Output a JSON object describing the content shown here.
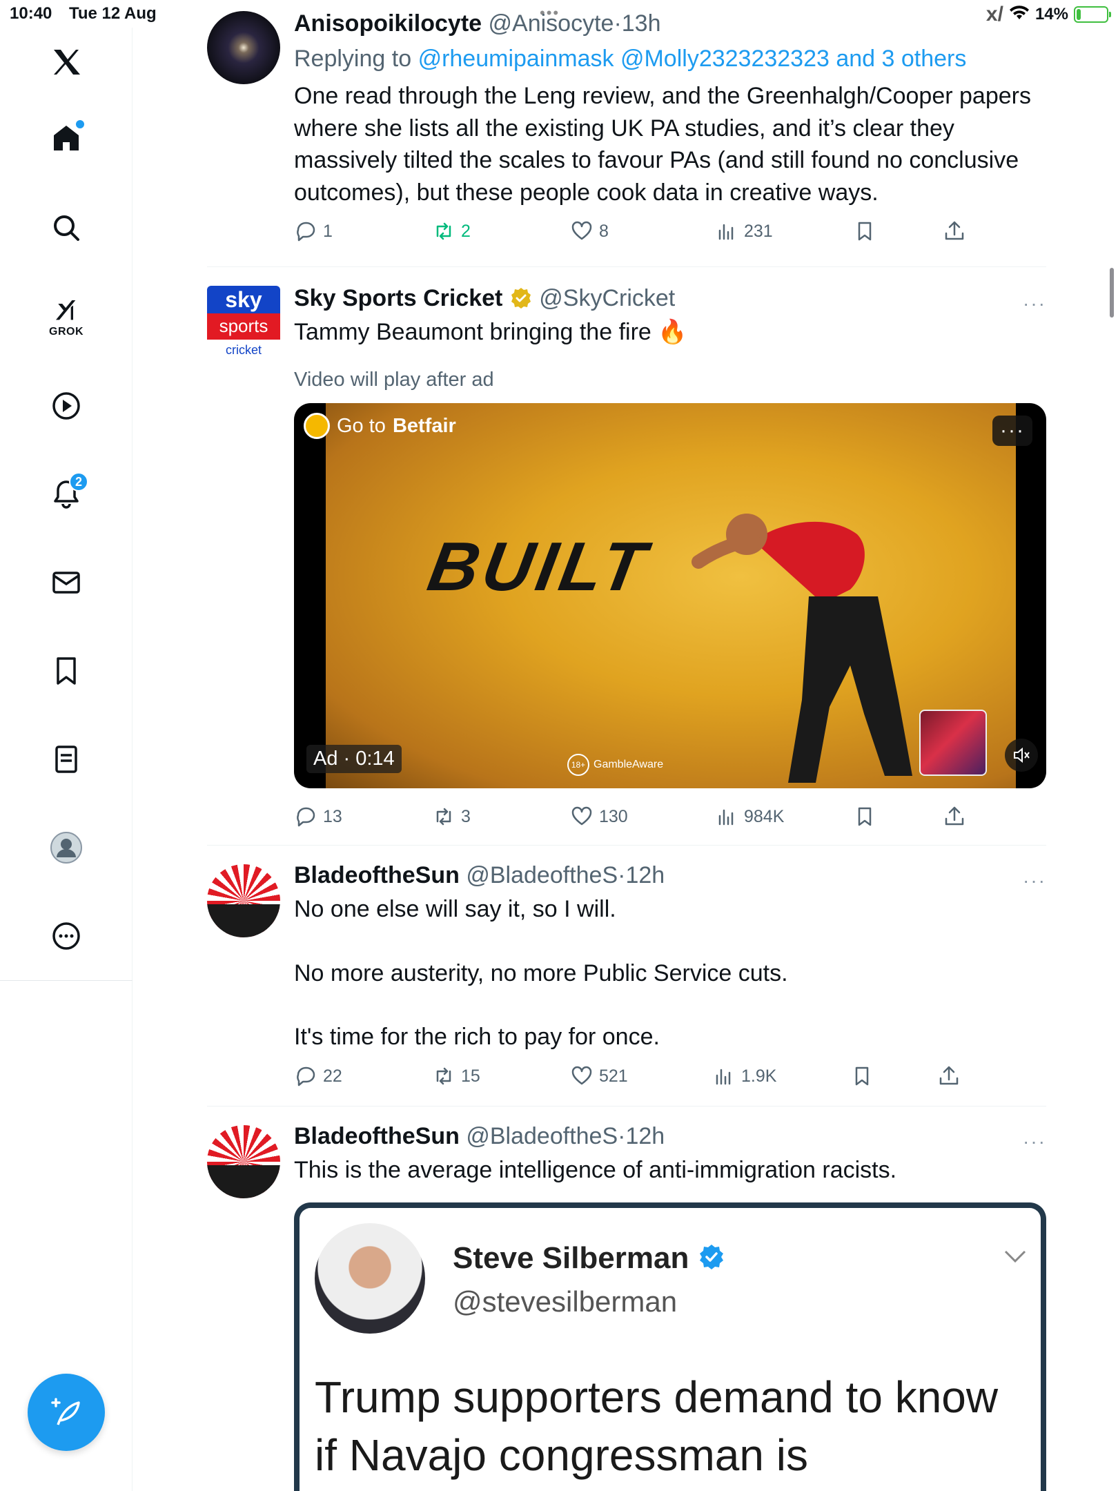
{
  "status_bar": {
    "time": "10:40",
    "date": "Tue 12 Aug",
    "battery": "14%",
    "battery_level": 0.14
  },
  "sidebar": {
    "notifications_badge": "2",
    "grok_label": "GROK",
    "items": [
      "home-icon",
      "search-icon",
      "grok-icon",
      "video-icon",
      "bell-icon",
      "mail-icon",
      "bookmark-icon",
      "lists-icon",
      "profile-icon",
      "more-icon"
    ]
  },
  "tweets": [
    {
      "name": "Anisopoikilocyte",
      "handle": "@Anisocyte",
      "time": "13h",
      "reply_prefix": "Replying to",
      "reply_to": "@rheumipainmask @Molly2323232323 and 3 others",
      "text": "One read through the Leng review, and the Greenhalgh/Cooper papers where she lists all the existing UK PA studies, and it’s clear they massively tilted the scales to favour PAs (and still found no conclusive outcomes), but these people cook data in creative ways.",
      "replies": "1",
      "reposts": "2",
      "likes": "8",
      "views": "231"
    },
    {
      "name": "Sky Sports Cricket",
      "handle": "@SkyCricket",
      "text": "Tammy Beaumont bringing the fire 🔥",
      "video_notice": "Video will play after ad",
      "ad_cta_prefix": "Go to",
      "ad_cta_brand": "Betfair",
      "ad_timer": "Ad · 0:14",
      "gamble_badge": "18+",
      "gamble_text": "GambleAware",
      "video_overlay_text": "BUILT",
      "thumb_count": "4",
      "avatar_line1": "sky",
      "avatar_line2": "sports",
      "avatar_line3": "cricket",
      "replies": "13",
      "reposts": "3",
      "likes": "130",
      "views": "984K"
    },
    {
      "name": "BladeoftheSun",
      "handle": "@BladeoftheS",
      "time": "12h",
      "text_lines": [
        "No one else will say it, so I will.",
        "No more austerity, no more Public Service cuts.",
        "It's time for the rich to pay for once."
      ],
      "replies": "22",
      "reposts": "15",
      "likes": "521",
      "views": "1.9K"
    },
    {
      "name": "BladeoftheSun",
      "handle": "@BladeoftheS",
      "time": "12h",
      "text": "This is the average intelligence of anti-immigration racists.",
      "embed": {
        "name": "Steve Silberman",
        "handle": "@stevesilberman",
        "text": "Trump supporters demand to know if Navajo congressman is"
      }
    }
  ],
  "colors": {
    "accent": "#1d9bf0",
    "secondary_text": "#536471",
    "repost_active": "#00ba7c",
    "verified_gold": "#e2b719"
  }
}
